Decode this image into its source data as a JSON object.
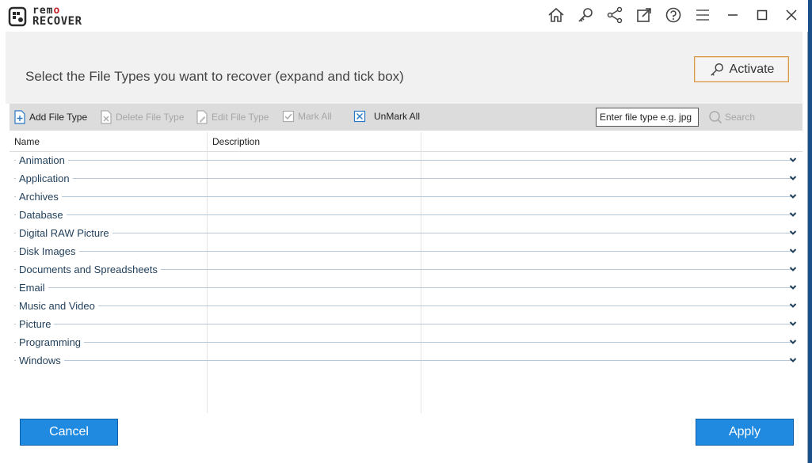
{
  "app": {
    "logo_top_left": "rem",
    "logo_top_right": "o",
    "logo_bottom": "RECOVER"
  },
  "titlebar": {
    "icons": [
      "home-icon",
      "key-icon",
      "share-icon",
      "external-link-icon",
      "help-icon",
      "menu-icon"
    ],
    "window_controls": [
      "minimize-icon",
      "maximize-icon",
      "close-icon"
    ]
  },
  "header": {
    "instruction": "Select the File Types you want to recover (expand and tick box)",
    "activate_label": "Activate"
  },
  "toolbar": {
    "add_file_type": "Add File Type",
    "delete_file_type": "Delete File Type",
    "edit_file_type": "Edit File Type",
    "mark_all": "Mark All",
    "unmark_all": "UnMark All",
    "search_placeholder": "Enter file type e.g. jpg",
    "search_label": "Search"
  },
  "list": {
    "columns": {
      "name": "Name",
      "description": "Description"
    },
    "categories": [
      "Animation",
      "Application",
      "Archives",
      "Database",
      "Digital RAW Picture",
      "Disk Images",
      "Documents and Spreadsheets",
      "Email",
      "Music and Video",
      "Picture",
      "Programming",
      "Windows"
    ]
  },
  "footer": {
    "cancel_label": "Cancel",
    "apply_label": "Apply"
  },
  "colors": {
    "accent_blue": "#1f8ae0",
    "activate_border": "#d89a4a",
    "row_text": "#1f3e5a",
    "toolbar_bg": "#dcdcdc"
  }
}
